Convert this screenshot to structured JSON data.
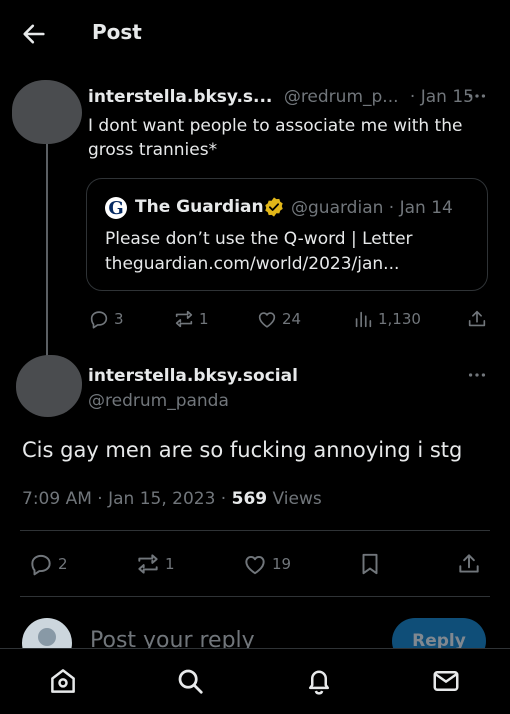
{
  "header": {
    "title": "Post"
  },
  "reply_tweet": {
    "display_name": "interstella.bksy.s...",
    "handle": "@redrum_p...",
    "date": "· Jan 15",
    "text": "I dont want people to associate me with the gross trannies*",
    "quote": {
      "source_logo": "G",
      "name": "The Guardian",
      "handle_date": "@guardian · Jan 14",
      "line1": "Please don’t use the Q-word | Letter",
      "line2": "theguardian.com/world/2023/jan..."
    },
    "actions": {
      "replies": "3",
      "reposts": "1",
      "likes": "24",
      "views": "1,130"
    }
  },
  "main_tweet": {
    "display_name": "interstella.bksy.social",
    "handle": "@redrum_panda",
    "text": "Cis gay men are so fucking annoying i stg",
    "timestamp": "7:09 AM · Jan 15, 2023 · ",
    "views_count": "569",
    "views_label": " Views",
    "actions": {
      "replies": "2",
      "reposts": "1",
      "likes": "19"
    }
  },
  "composer": {
    "placeholder": "Post your reply",
    "button": "Reply"
  },
  "icons": {
    "back": "back-arrow-icon",
    "more": "more-icon",
    "verified": "verified-badge-icon",
    "reply": "reply-icon",
    "repost": "repost-icon",
    "like": "like-icon",
    "views": "views-icon",
    "bookmark": "bookmark-icon",
    "share": "share-icon",
    "home": "home-icon",
    "search": "search-icon",
    "notifications": "bell-icon",
    "messages": "mail-icon"
  },
  "colors": {
    "background": "#000000",
    "text": "#e7e9ea",
    "muted": "#71767b",
    "border": "#2f3336",
    "verified_gold": "#e2b719",
    "reply_button": "#0f4e78"
  }
}
